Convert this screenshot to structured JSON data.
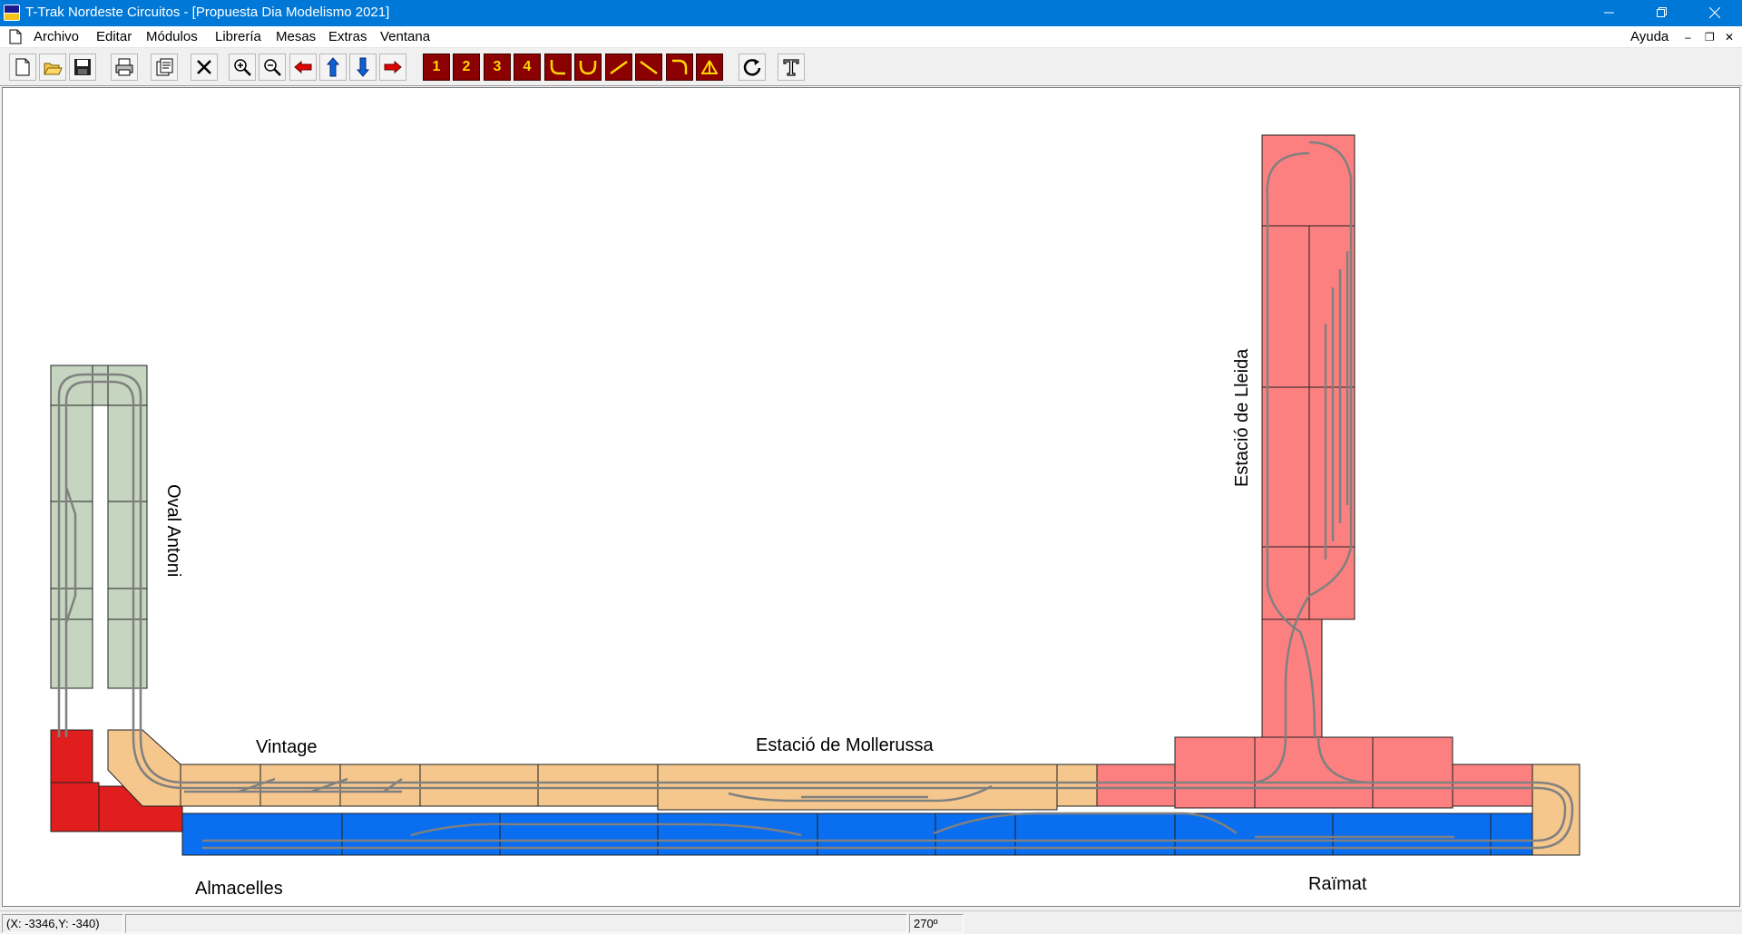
{
  "window": {
    "title": "T-Trak Nordeste Circuitos - [Propuesta Dia Modelismo 2021]"
  },
  "menu": {
    "items": [
      "Archivo",
      "Editar",
      "Módulos",
      "Librería",
      "Mesas",
      "Extras",
      "Ventana"
    ],
    "help": "Ayuda"
  },
  "toolbar": {
    "buttons": [
      {
        "icon": "new-document-icon"
      },
      {
        "icon": "open-folder-icon"
      },
      {
        "icon": "save-icon"
      },
      {
        "icon": "print-icon"
      },
      {
        "icon": "properties-icon"
      },
      {
        "icon": "delete-icon"
      },
      {
        "icon": "zoom-in-icon"
      },
      {
        "icon": "zoom-out-icon"
      },
      {
        "icon": "move-left-icon"
      },
      {
        "icon": "move-up-icon"
      },
      {
        "icon": "move-down-icon"
      },
      {
        "icon": "move-right-icon"
      },
      {
        "icon": "module-1-icon",
        "label": "1"
      },
      {
        "icon": "module-2-icon",
        "label": "2"
      },
      {
        "icon": "module-3-icon",
        "label": "3"
      },
      {
        "icon": "module-4-icon",
        "label": "4"
      },
      {
        "icon": "curve-corner-icon"
      },
      {
        "icon": "curve-u-icon"
      },
      {
        "icon": "diagonal-right-icon"
      },
      {
        "icon": "diagonal-left-icon"
      },
      {
        "icon": "curve-corner-2-icon"
      },
      {
        "icon": "turntable-icon"
      },
      {
        "icon": "rotate-icon"
      },
      {
        "icon": "text-tool-icon"
      }
    ]
  },
  "layout": {
    "colors": {
      "oval": "#c6d5bf",
      "red": "#e01e1e",
      "tan": "#f5c78d",
      "blue": "#0a6ef0",
      "pink": "#fc8080",
      "track": "#808080",
      "border": "#202020"
    },
    "labels": {
      "oval": "Oval Antoni",
      "vintage": "Vintage",
      "mollerussa": "Estació de Mollerussa",
      "lleida": "Estació de Lleida",
      "almacelles": "Almacelles",
      "raimat": "Raïmat"
    }
  },
  "status": {
    "coords": "(X:   -3346,Y:    -340)",
    "angle": "270º"
  }
}
